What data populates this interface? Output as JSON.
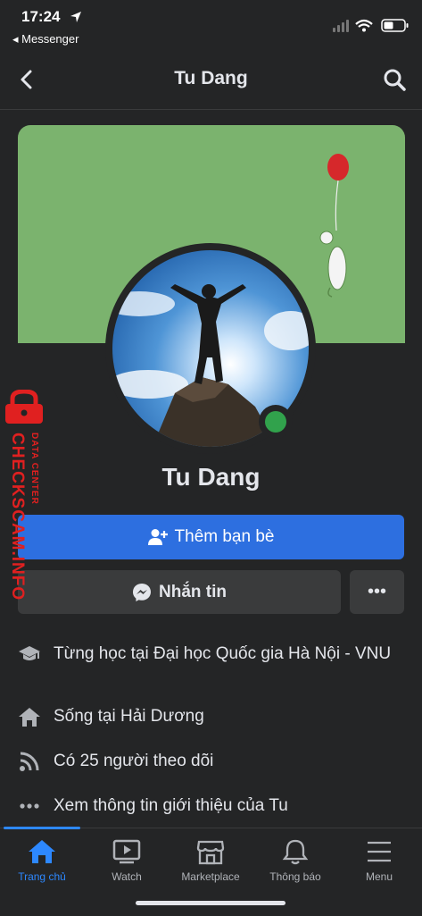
{
  "status_bar": {
    "time": "17:24",
    "back_app": "◂ Messenger"
  },
  "header": {
    "title": "Tu Dang"
  },
  "profile": {
    "name": "Tu Dang",
    "add_friend_label": "Thêm bạn bè",
    "message_label": "Nhắn tin",
    "more_label": "•••"
  },
  "info": [
    {
      "icon": "graduation-cap-icon",
      "text": "Từng học tại Đại học Quốc gia Hà Nội - VNU"
    },
    {
      "icon": "home-icon",
      "text": "Sống tại Hải Dương"
    },
    {
      "icon": "rss-icon",
      "text": "Có 25 người theo dõi"
    },
    {
      "icon": "more-dots-icon",
      "text": "Xem thông tin giới thiệu của Tu"
    }
  ],
  "tabs": [
    {
      "label": "Trang chủ",
      "icon": "home-icon",
      "active": true
    },
    {
      "label": "Watch",
      "icon": "watch-icon",
      "active": false
    },
    {
      "label": "Marketplace",
      "icon": "marketplace-icon",
      "active": false
    },
    {
      "label": "Thông báo",
      "icon": "bell-icon",
      "active": false
    },
    {
      "label": "Menu",
      "icon": "menu-icon",
      "active": false
    }
  ],
  "watermark": {
    "brand": "CHECKSCAM.INFO",
    "sub": "DATA CENTER"
  },
  "colors": {
    "accent": "#2d88ff",
    "button": "#2d6fe0",
    "online": "#31a24c",
    "cover": "#7bb36e"
  }
}
